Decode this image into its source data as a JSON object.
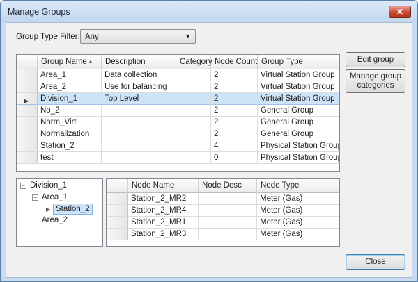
{
  "window": {
    "title": "Manage Groups",
    "close_glyph": "✕"
  },
  "filter": {
    "label": "Group Type Filter:",
    "value": "Any",
    "arrow": "▼"
  },
  "buttons": {
    "edit_group": "Edit group",
    "manage_line1": "Manage group",
    "manage_line2": "categories",
    "close": "Close"
  },
  "groups_grid": {
    "columns": [
      "Group Name",
      "Description",
      "Category",
      "Node Count",
      "Group Type"
    ],
    "sort_glyph": "▲",
    "selected_glyph": "▶",
    "rows": [
      {
        "name": "Area_1",
        "description": "Data collection",
        "category": "",
        "node_count": "2",
        "group_type": "Virtual Station Group"
      },
      {
        "name": "Area_2",
        "description": "Use for balancing",
        "category": "",
        "node_count": "2",
        "group_type": "Virtual Station Group"
      },
      {
        "name": "Division_1",
        "description": "Top Level",
        "category": "",
        "node_count": "2",
        "group_type": "Virtual Station Group"
      },
      {
        "name": "No_2",
        "description": "",
        "category": "",
        "node_count": "2",
        "group_type": "General Group"
      },
      {
        "name": "Norm_Virt",
        "description": "",
        "category": "",
        "node_count": "2",
        "group_type": "General Group"
      },
      {
        "name": "Normalization",
        "description": "",
        "category": "",
        "node_count": "2",
        "group_type": "General Group"
      },
      {
        "name": "Station_2",
        "description": "",
        "category": "",
        "node_count": "4",
        "group_type": "Physical Station Group"
      },
      {
        "name": "test",
        "description": "",
        "category": "",
        "node_count": "0",
        "group_type": "Physical Station Group"
      }
    ]
  },
  "tree": {
    "collapse_glyph": "−",
    "expand_arrow": "▶",
    "nodes": [
      "Division_1",
      "Area_1",
      "Station_2",
      "Area_2"
    ]
  },
  "nodes_grid": {
    "columns": [
      "Node Name",
      "Node Desc",
      "Node Type"
    ],
    "rows": [
      {
        "name": "Station_2_MR2",
        "desc": "",
        "type": "Meter (Gas)"
      },
      {
        "name": "Station_2_MR4",
        "desc": "",
        "type": "Meter (Gas)"
      },
      {
        "name": "Station_2_MR1",
        "desc": "",
        "type": "Meter (Gas)"
      },
      {
        "name": "Station_2_MR3",
        "desc": "",
        "type": "Meter (Gas)"
      }
    ]
  }
}
